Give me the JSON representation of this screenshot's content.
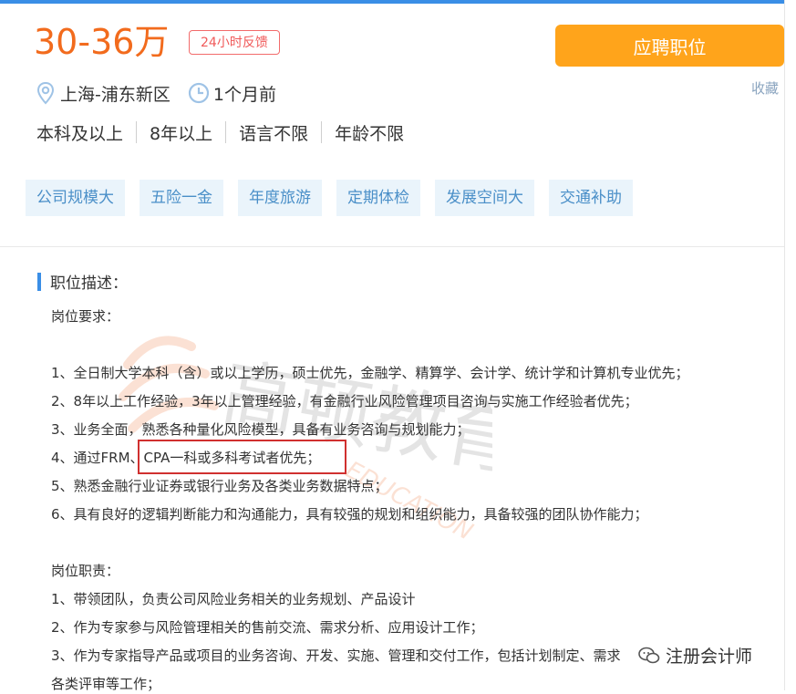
{
  "job": {
    "salary": "30-36万",
    "feedback_badge": "24小时反馈",
    "apply_button": "应聘职位",
    "favorite_link": "收藏",
    "location": "上海-浦东新区",
    "posted": "1个月前",
    "requirements": [
      "本科及以上",
      "8年以上",
      "语言不限",
      "年龄不限"
    ],
    "benefit_tags": [
      "公司规模大",
      "五险一金",
      "年度旅游",
      "定期体检",
      "发展空间大",
      "交通补助"
    ]
  },
  "description": {
    "section_title": "职位描述：",
    "req_heading": "岗位要求：",
    "req_items": [
      "1、全日制大学本科（含）或以上学历，硕士优先，金融学、精算学、会计学、统计学和计算机专业优先；",
      "2、8年以上工作经验，3年以上管理经验，有金融行业风险管理项目咨询与实施工作经验者优先；",
      "3、业务全面，熟悉各种量化风险模型，具备有业务咨询与规划能力；",
      "4、通过FRM、CPA一科或多科考试者优先；",
      "5、熟悉金融行业证券或银行业务及各类业务数据特点；",
      "6、具有良好的逻辑判断能力和沟通能力，具有较强的规划和组织能力，具备较强的团队协作能力；"
    ],
    "duty_heading": "岗位职责：",
    "duty_items": [
      "1、带领团队，负责公司风险业务相关的业务规划、产品设计",
      "2、作为专家参与风险管理相关的售前交流、需求分析、应用设计工作；",
      "3、作为专家指导产品或项目的业务咨询、开发、实施、管理和交付工作，包括计划制定、需求",
      "各类评审等工作；"
    ]
  },
  "watermark": {
    "brand": "高顿教育",
    "sub": "EDUCATION"
  },
  "wechat_label": "注册会计师",
  "colors": {
    "salary": "#f26b1d",
    "apply_button": "#ffa41b",
    "tag_bg": "#eaf4fb",
    "tag_text": "#4a8fc8",
    "accent": "#3a8ee6",
    "highlight": "#d0302f"
  }
}
